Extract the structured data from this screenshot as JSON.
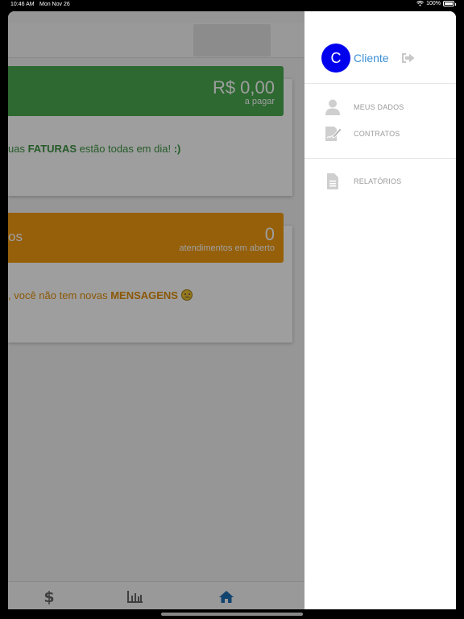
{
  "status_bar": {
    "time": "10:46 AM",
    "date": "Mon Nov 26",
    "battery": "100%"
  },
  "faturas_card": {
    "amount": "R$ 0,00",
    "caption": "a pagar",
    "msg_prefix": "uas ",
    "msg_bold": "FATURAS",
    "msg_rest": " estão todas em dia! ",
    "msg_end": ":)"
  },
  "atendimentos_card": {
    "left_label": "os",
    "count": "0",
    "caption": "atendimentos em aberto",
    "msg_prefix": ", você não tem novas ",
    "msg_bold": "MENSAGENS"
  },
  "drawer": {
    "avatar_letter": "C",
    "user_name": "Cliente",
    "menu": [
      {
        "label": "MEUS DADOS",
        "icon": "user-icon"
      },
      {
        "label": "CONTRATOS",
        "icon": "contract-icon"
      },
      {
        "label": "RELATÓRIOS",
        "icon": "report-icon"
      }
    ]
  },
  "tabbar": {
    "active_tab": "home"
  },
  "colors": {
    "green": "#4aaa4f",
    "orange": "#f39c12",
    "accent_blue": "#3a8fd6",
    "avatar_blue": "#0000ee"
  }
}
